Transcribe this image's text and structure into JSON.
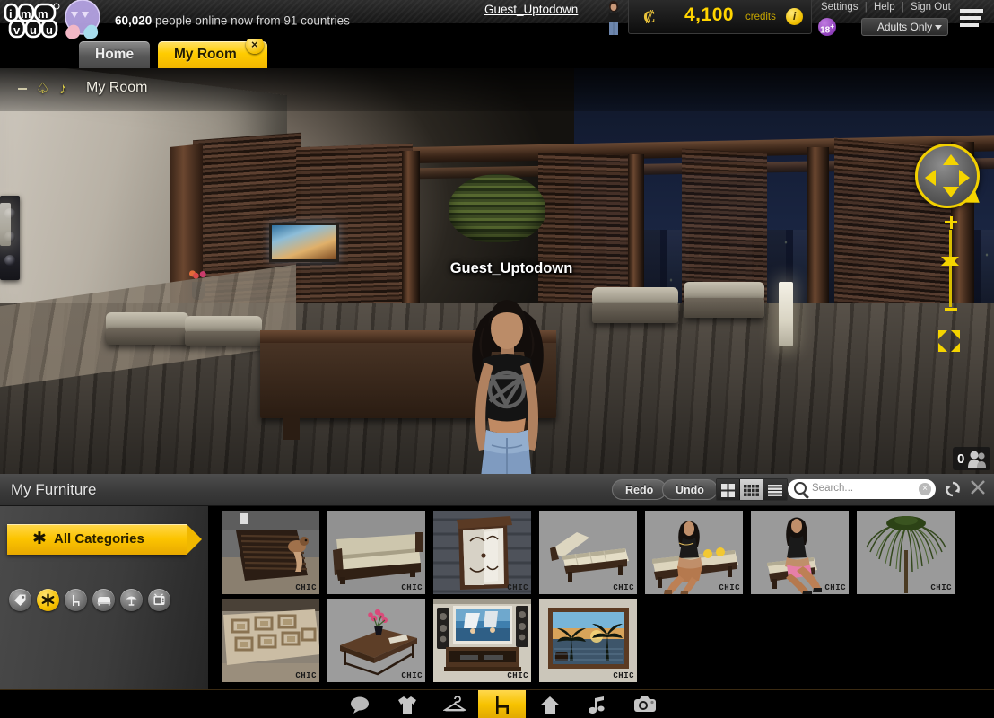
{
  "header": {
    "logo_text": "imvu",
    "online_count": "60,020",
    "online_text_suffix": " people online now from 91 countries",
    "online_full": "60,020 people online now from 91 countries",
    "tabs": [
      {
        "label": "Home",
        "active": false
      },
      {
        "label": "My Room",
        "active": true,
        "close_icon": "×"
      }
    ],
    "user_name": "Guest_Uptodown",
    "credits": {
      "currency_symbol": "₡",
      "amount": "4,100",
      "label": "credits",
      "info_icon": "i"
    },
    "links": {
      "settings": "Settings",
      "help": "Help",
      "signout": "Sign Out",
      "separator": "|"
    },
    "rating": {
      "badge": "18",
      "badge_sup": "+",
      "value": "Adults Only"
    },
    "menu_icon": "hamburger-menu-icon"
  },
  "room": {
    "title": "My Room",
    "icons": [
      "mic-icon",
      "music-note-icon"
    ],
    "avatar_name": "Guest_Uptodown",
    "people_count": "0",
    "controls": {
      "compass": "pan-compass",
      "zoom_in": "+",
      "zoom_out": "−",
      "expand": "expand-view-icon"
    }
  },
  "furniture": {
    "title": "My Furniture",
    "buttons": {
      "redo": "Redo",
      "undo": "Undo"
    },
    "view_modes": [
      {
        "name": "large-grid-view",
        "active": false
      },
      {
        "name": "small-grid-view",
        "active": true
      },
      {
        "name": "list-view",
        "active": false
      }
    ],
    "search": {
      "placeholder": "Search...",
      "value": "",
      "clear_icon": "×"
    },
    "refresh_icon": "refresh-icon",
    "close_icon": "×",
    "category_button": {
      "label": "All Categories",
      "icon": "asterisk-icon"
    },
    "category_icons": [
      {
        "name": "tag-icon",
        "active": false
      },
      {
        "name": "asterisk-icon",
        "active": true
      },
      {
        "name": "chair-icon",
        "active": false
      },
      {
        "name": "sofa-icon",
        "active": false
      },
      {
        "name": "lamp-icon",
        "active": false
      },
      {
        "name": "tv-icon",
        "active": false
      }
    ],
    "badge_text": "CHIC",
    "items_row1": [
      {
        "name": "slat-bench-with-pet",
        "badge": "CHIC"
      },
      {
        "name": "beige-sofa",
        "badge": "CHIC"
      },
      {
        "name": "glass-display-cabinet",
        "badge": "CHIC"
      },
      {
        "name": "chaise-lounge",
        "badge": "CHIC"
      },
      {
        "name": "daybed-with-avatar",
        "badge": "CHIC"
      },
      {
        "name": "ottoman-with-avatar",
        "badge": "CHIC"
      },
      {
        "name": "weeping-plant",
        "badge": "CHIC"
      }
    ],
    "items_row2": [
      {
        "name": "geometric-area-rug",
        "badge": "CHIC"
      },
      {
        "name": "coffee-table-with-vase",
        "badge": "CHIC"
      },
      {
        "name": "tv-entertainment-center",
        "badge": "CHIC"
      },
      {
        "name": "palm-sunset-artwork",
        "badge": "CHIC"
      }
    ]
  },
  "bottom_nav": [
    {
      "name": "chat-icon",
      "active": false
    },
    {
      "name": "shirt-icon",
      "active": false
    },
    {
      "name": "hanger-icon",
      "active": false
    },
    {
      "name": "furniture-chair-icon",
      "active": true
    },
    {
      "name": "home-icon",
      "active": false
    },
    {
      "name": "music-note-icon",
      "active": false
    },
    {
      "name": "camera-icon",
      "active": false
    }
  ],
  "colors": {
    "accent_yellow": "#f5c000",
    "tab_active": "#ffcc00",
    "panel_gray": "#3c3c3c",
    "background": "#000000",
    "credits_text": "#ffd400"
  }
}
